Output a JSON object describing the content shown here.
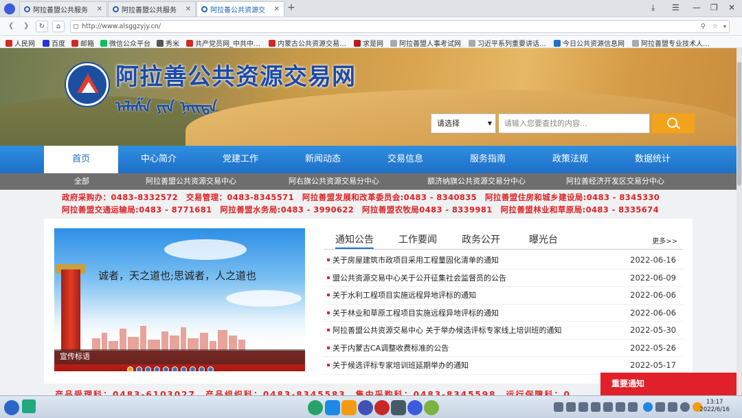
{
  "browser": {
    "tabs": [
      {
        "label": "阿拉善盟公共服务"
      },
      {
        "label": "阿拉善盟公共服务"
      },
      {
        "label": "阿拉善公共资源交"
      }
    ],
    "new_tab": "+",
    "url": "http://www.alsggzyjy.cn/",
    "bookmarks": [
      {
        "label": "人民网",
        "color": "#d22a1e"
      },
      {
        "label": "百度",
        "color": "#2932e1"
      },
      {
        "label": "邮箱",
        "color": "#d22a1e"
      },
      {
        "label": "微信公众平台",
        "color": "#07c160"
      },
      {
        "label": "秀米",
        "color": "#555"
      },
      {
        "label": "共产党员网_中共中…",
        "color": "#d22a1e"
      },
      {
        "label": "内蒙古公共资源交易…",
        "color": "#d22a1e"
      },
      {
        "label": "求是网",
        "color": "#b71c1c"
      },
      {
        "label": "阿拉善盟人事考试网",
        "color": "#aaa"
      },
      {
        "label": "习近平系列重要讲话…",
        "color": "#aaa"
      },
      {
        "label": "今日公共资源信息网",
        "color": "#1e6fc7"
      },
      {
        "label": "阿拉善盟专业技术人…",
        "color": "#aaa"
      }
    ]
  },
  "site": {
    "title": "阿拉善公共资源交易网",
    "mongolian": "ᠠᠯᠠᠱᠠ ᠶᠢᠨ ᠨᠡᠢᠲᠡ",
    "search": {
      "select_value": "请选择",
      "placeholder": "请输入您要查找的内容..."
    },
    "main_nav": [
      "首页",
      "中心简介",
      "党建工作",
      "新闻动态",
      "交易信息",
      "服务指南",
      "政策法规",
      "数据统计"
    ],
    "sub_nav": [
      "全部",
      "阿拉善盟公共资源交易中心",
      "阿右旗公共资源交易分中心",
      "额济纳旗公共资源交易分中心",
      "阿拉善经济开发区交易分中心"
    ],
    "phones": {
      "line1": "政府采购办：0483-8332572　交易管理：0483-8345571　阿拉善盟发展和改革委员会:0483 - 8340835　阿拉善盟住房和城乡建设局:0483 - 8345330",
      "line2": "阿拉善盟交通运输局:0483 - 8771681　阿拉善盟水务局:0483 - 3990622　阿拉善盟农牧局0483 - 8339981　阿拉善盟林业和草原局:0483 - 8335674"
    },
    "slide": {
      "slogan": "诚者，天之道也;思诚者，人之道也",
      "caption": "宣传标语"
    },
    "news_tabs": [
      "通知公告",
      "工作要闻",
      "政务公开",
      "曝光台"
    ],
    "more": "更多>>",
    "news": [
      {
        "title": "关于房屋建筑市政项目采用工程量固化清单的通知",
        "date": "2022-06-16"
      },
      {
        "title": "盟公共资源交易中心关于公开征集社会监督员的公告",
        "date": "2022-06-09"
      },
      {
        "title": "关于水利工程项目实施远程异地评标的通知",
        "date": "2022-06-06"
      },
      {
        "title": "关于林业和草原工程项目实施远程异地评标的通知",
        "date": "2022-06-06"
      },
      {
        "title": "阿拉善盟公共资源交易中心 关于举办候选评标专家线上培训班的通知",
        "date": "2022-05-30"
      },
      {
        "title": "关于内蒙古CA调整收费标准的公告",
        "date": "2022-05-26"
      },
      {
        "title": "关于候选评标专家培训班延期举办的通知",
        "date": "2022-05-17"
      }
    ],
    "bottom_partial": "产品受理科：0483-6103027　产品组织科：0483-8345583　集中采购科：0483-8345598　运行保障科：0",
    "notice_button": "重要通知"
  },
  "taskbar": {
    "time": "13:17",
    "date": "2022/6/16"
  }
}
